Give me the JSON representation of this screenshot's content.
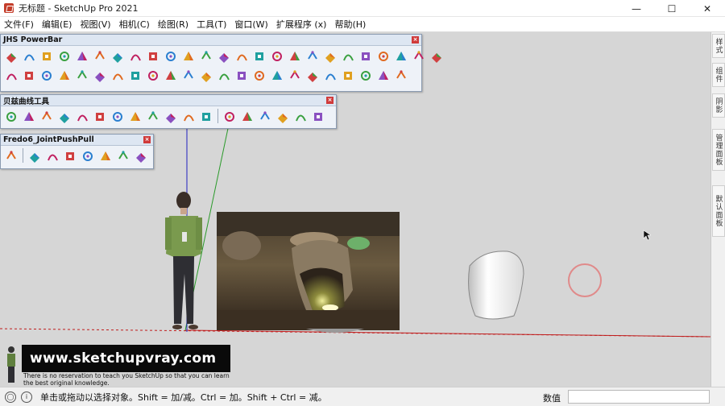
{
  "window": {
    "title": "无标题 - SketchUp Pro 2021",
    "minimize": "—",
    "maximize": "☐",
    "close": "✕"
  },
  "menu": [
    "文件(F)",
    "编辑(E)",
    "视图(V)",
    "相机(C)",
    "绘图(R)",
    "工具(T)",
    "窗口(W)",
    "扩展程序 (x)",
    "帮助(H)"
  ],
  "toolbars": {
    "powerbar": {
      "title": "JHS PowerBar",
      "row1_count": 25,
      "row2_count": 23
    },
    "bezier": {
      "title": "贝兹曲线工具",
      "count": 18
    },
    "pushpull": {
      "title": "Fredo6_JointPushPull",
      "count": 8
    }
  },
  "right_panel": {
    "tabs": [
      "样式",
      "组件",
      "阴影",
      "管理面板",
      "默认面板"
    ]
  },
  "watermark": {
    "url": "www.sketchupvray.com",
    "line1": "There is no reservation to teach you SketchUp so that you can learn",
    "line2": "the best original knowledge."
  },
  "status": {
    "message": "单击或拖动以选择对象。Shift = 加/减。Ctrl = 加。Shift + Ctrl = 减。",
    "value_label": "数值",
    "value": ""
  },
  "colors": {
    "axis_red": "#c01c1c",
    "axis_green": "#2a9a2a",
    "axis_blue": "#2020c0",
    "toolbar_bg": "#eef2f8"
  }
}
